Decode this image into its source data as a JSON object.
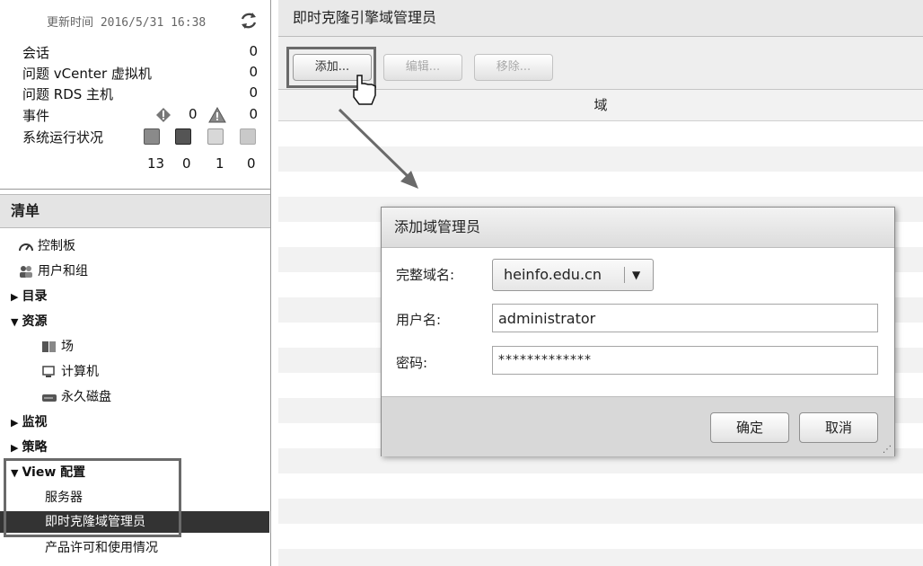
{
  "sidebar": {
    "update_time": "更新时间 2016/5/31 16:38",
    "status": {
      "sessions": {
        "label": "会话",
        "value": "0"
      },
      "problem_vms": {
        "label": "问题 vCenter 虚拟机",
        "value": "0"
      },
      "problem_rds": {
        "label": "问题 RDS 主机",
        "value": "0"
      },
      "events": {
        "label": "事件",
        "warn_count": "0",
        "alert_count": "0"
      },
      "health": {
        "label": "系统运行状况",
        "counts": [
          "13",
          "0",
          "1",
          "0"
        ]
      }
    },
    "inventory_title": "清单",
    "nav": {
      "dashboard": "控制板",
      "users_groups": "用户和组",
      "catalog": "目录",
      "resources": "资源",
      "farms": "场",
      "machines": "计算机",
      "persistent_disks": "永久磁盘",
      "monitoring": "监视",
      "policies": "策略",
      "view_config": "View 配置",
      "servers": "服务器",
      "instant_clone_admins": "即时克隆域管理员",
      "product_licensing": "产品许可和使用情况"
    }
  },
  "main": {
    "title": "即时克隆引擎域管理员",
    "toolbar": {
      "add": "添加...",
      "edit": "编辑...",
      "remove": "移除..."
    },
    "column_header": "域"
  },
  "dialog": {
    "title": "添加域管理员",
    "domain_label": "完整域名:",
    "domain_value": "heinfo.edu.cn",
    "username_label": "用户名:",
    "username_value": "administrator",
    "password_label": "密码:",
    "password_value": "*************",
    "ok": "确定",
    "cancel": "取消"
  }
}
